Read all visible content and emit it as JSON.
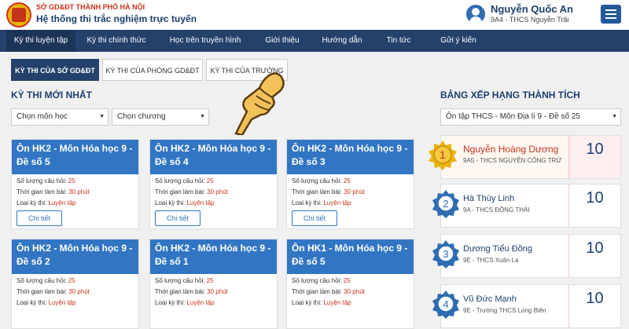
{
  "header": {
    "org": "SỞ GD&ĐT THÀNH PHỐ HÀ NỘI",
    "system": "Hệ thống thi trắc nghiệm trực tuyến",
    "user_name": "Nguyễn Quốc An",
    "user_class": "9A4 - THCS Nguyễn Trãi",
    "logo_icon": "emblem-icon",
    "menu_icon": "hamburger-icon"
  },
  "nav": [
    "Kỳ thi luyện tập",
    "Kỳ thi chính thức",
    "Học trên truyền hình",
    "Giới thiệu",
    "Hướng dẫn",
    "Tin tức",
    "Gửi ý kiến"
  ],
  "tabs": [
    "KỲ THI CỦA SỞ GD&ĐT",
    "KỲ THI CỦA PHÒNG GD&ĐT",
    "KỲ THI CỦA TRƯỜNG"
  ],
  "latest": {
    "title": "KỲ THI MỚI NHẤT",
    "subject_placeholder": "Chọn môn học",
    "chapter_placeholder": "Chọn chương"
  },
  "card_labels": {
    "questions": "Số lượng câu hỏi:",
    "time": "Thời gian làm bài:",
    "type": "Loại kỳ thi:",
    "detail": "Chi tiết"
  },
  "cards": [
    {
      "title": "Ôn HK2 - Môn Hóa học 9 - Đề số 5",
      "questions": "25",
      "time": "30 phút",
      "type": "Luyện tập"
    },
    {
      "title": "Ôn HK2 - Môn Hóa học 9 - Đề số 4",
      "questions": "25",
      "time": "30 phút",
      "type": "Luyện tập"
    },
    {
      "title": "Ôn HK2 - Môn Hóa học 9 - Đề số 3",
      "questions": "25",
      "time": "30 phút",
      "type": "Luyện tập"
    },
    {
      "title": "Ôn HK2 - Môn Hóa học 9 - Đề số 2",
      "questions": "25",
      "time": "30 phút",
      "type": "Luyện tập"
    },
    {
      "title": "Ôn HK2 - Môn Hóa học 9 - Đề số 1",
      "questions": "25",
      "time": "30 phút",
      "type": "Luyện tập"
    },
    {
      "title": "Ôn HK1 - Môn Hóa học 9 - Đề số 5",
      "questions": "25",
      "time": "30 phút",
      "type": "Luyện tập"
    }
  ],
  "ranking": {
    "title": "BẢNG XẾP HẠNG THÀNH TÍCH",
    "select": "Ôn tập THCS - Môn Địa lí 9 - Đề số 25",
    "entries": [
      {
        "rank": "1",
        "name": "Nguyễn Hoàng Dương",
        "class": "9A5 - THCS NGUYỄN CÔNG TRỨ",
        "score": "10"
      },
      {
        "rank": "2",
        "name": "Hà Thùy Linh",
        "class": "9A - THCS ĐÔNG THÁI",
        "score": "10"
      },
      {
        "rank": "3",
        "name": "Dương Tiểu Đồng",
        "class": "9E - THCS Xuân La",
        "score": "10"
      },
      {
        "rank": "4",
        "name": "Vũ Đức Mạnh",
        "class": "9E - Trường THCS Long Biên",
        "score": "10"
      }
    ]
  },
  "colors": {
    "navy": "#24416b",
    "blue": "#3276c3",
    "red": "#c7321b",
    "gold": "#e8b40a"
  }
}
